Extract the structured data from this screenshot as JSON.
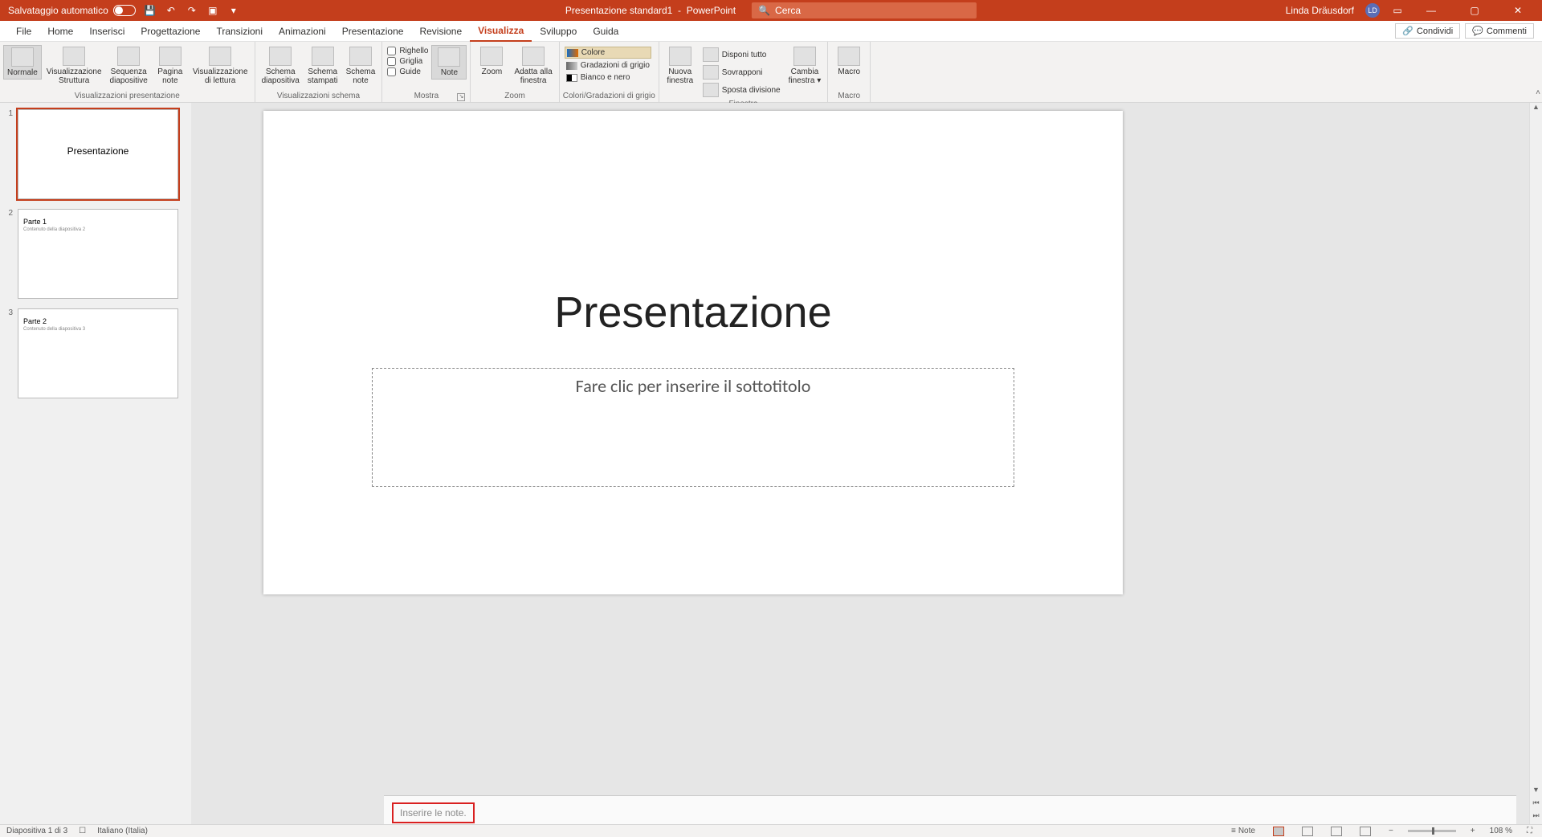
{
  "titlebar": {
    "autosave": "Salvataggio automatico",
    "doc_title": "Presentazione standard1",
    "app_name": "PowerPoint",
    "search_placeholder": "Cerca",
    "user_name": "Linda Dräusdorf",
    "user_initials": "LD"
  },
  "tabs": {
    "items": [
      "File",
      "Home",
      "Inserisci",
      "Progettazione",
      "Transizioni",
      "Animazioni",
      "Presentazione",
      "Revisione",
      "Visualizza",
      "Sviluppo",
      "Guida"
    ],
    "active_index": 8,
    "share": "Condividi",
    "comments": "Commenti"
  },
  "ribbon": {
    "g_presviews": {
      "label": "Visualizzazioni presentazione",
      "normal": "Normale",
      "outline": "Visualizzazione\nStruttura",
      "sorter": "Sequenza\ndiapositive",
      "notes_page": "Pagina\nnote",
      "reading": "Visualizzazione\ndi lettura"
    },
    "g_master": {
      "label": "Visualizzazioni schema",
      "slide_master": "Schema\ndiapositiva",
      "handout_master": "Schema\nstampati",
      "notes_master": "Schema\nnote"
    },
    "g_show": {
      "label": "Mostra",
      "ruler": "Righello",
      "grid": "Griglia",
      "guides": "Guide",
      "notes": "Note"
    },
    "g_zoom": {
      "label": "Zoom",
      "zoom": "Zoom",
      "fit": "Adatta alla\nfinestra"
    },
    "g_color": {
      "label": "Colori/Gradazioni di grigio",
      "color": "Colore",
      "gray": "Gradazioni di grigio",
      "bw": "Bianco e nero"
    },
    "g_window": {
      "label": "Finestra",
      "new_window": "Nuova\nfinestra",
      "arrange_all": "Disponi tutto",
      "cascade": "Sovrapponi",
      "move_split": "Sposta divisione",
      "switch": "Cambia\nfinestra"
    },
    "g_macro": {
      "label": "Macro",
      "macros": "Macro"
    }
  },
  "thumbnails": [
    {
      "num": "1",
      "title": "Presentazione",
      "selected": true,
      "subtitle": ""
    },
    {
      "num": "2",
      "title": "Parte 1",
      "subtitle": "Contenuto della diapositiva 2"
    },
    {
      "num": "3",
      "title": "Parte 2",
      "subtitle": "Contenuto della diapositiva 3"
    }
  ],
  "slide": {
    "title": "Presentazione",
    "subtitle_placeholder": "Fare clic per inserire il sottotitolo"
  },
  "notes": {
    "placeholder": "Inserire le note."
  },
  "statusbar": {
    "slide_info": "Diapositiva 1 di 3",
    "language": "Italiano (Italia)",
    "notes_btn": "Note",
    "zoom_pct": "108 %"
  }
}
